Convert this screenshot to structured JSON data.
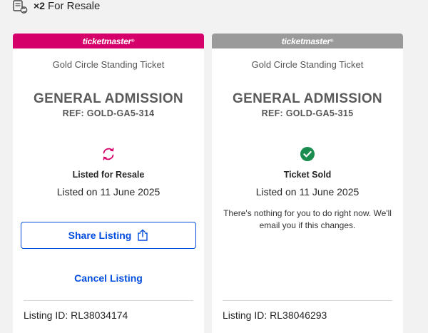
{
  "header": {
    "count": "×2",
    "label": "For Resale"
  },
  "brand": "ticketmaster",
  "tickets": [
    {
      "type": "Gold Circle Standing Ticket",
      "admission": "GENERAL ADMISSION",
      "ref": "REF: GOLD-GA5-314",
      "status": "Listed for Resale",
      "listed_on": "Listed on 11 June 2025",
      "share_label": "Share Listing",
      "cancel_label": "Cancel Listing",
      "listing_id": "Listing ID: RL38034174",
      "status_icon": "resale-arrows-icon",
      "accent": "#d6006b"
    },
    {
      "type": "Gold Circle Standing Ticket",
      "admission": "GENERAL ADMISSION",
      "ref": "REF: GOLD-GA5-315",
      "status": "Ticket Sold",
      "listed_on": "Listed on 11 June 2025",
      "note": "There's nothing for you to do right now. We'll email you if this changes.",
      "listing_id": "Listing ID: RL38046293",
      "status_icon": "check-circle-icon",
      "accent": "#9a9a9a"
    }
  ],
  "colors": {
    "link": "#024ddf",
    "sold_green": "#1a8c4e",
    "resale_pink": "#d6006b"
  }
}
